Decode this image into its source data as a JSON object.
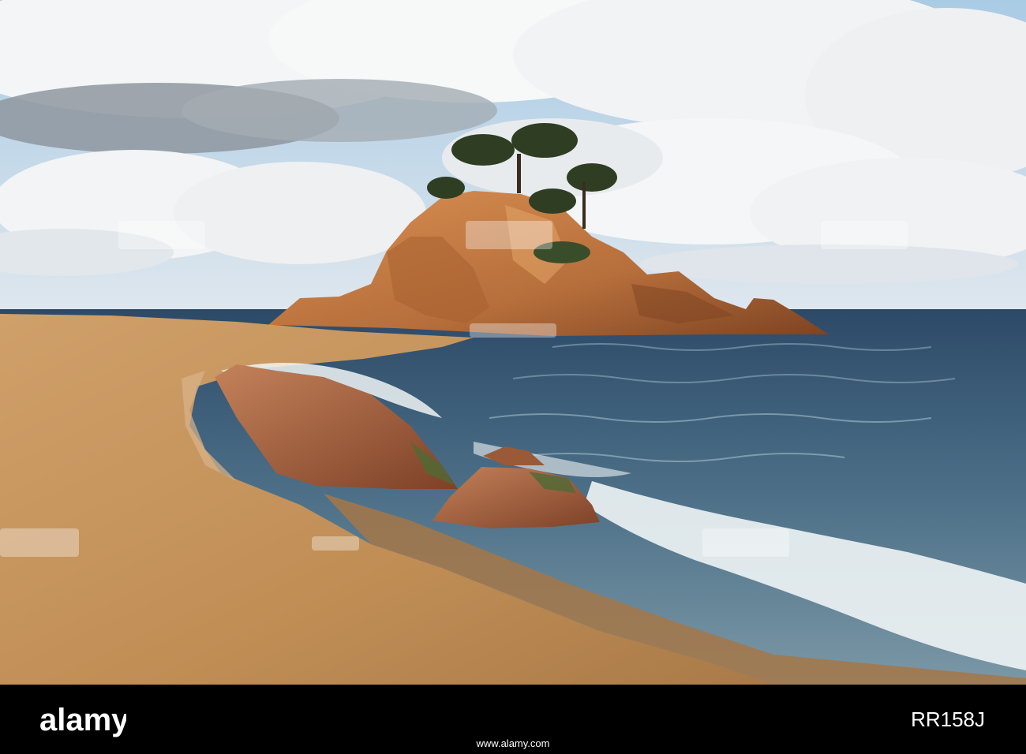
{
  "photo": {
    "description_icon": "beach-photo",
    "colors": {
      "sky_top": "#9fc3de",
      "cloud": "#f2f3f4",
      "cloud_shadow": "#8e969e",
      "sea_deep": "#2f4f6e",
      "sea_mid": "#5d7f96",
      "foam": "#eef4f5",
      "sand": "#c8965a",
      "sand_wet": "#b5834c",
      "rock": "#c07a45",
      "rock_dark": "#8a4d2a",
      "tree": "#2e3d22"
    }
  },
  "watermark": {
    "brand": "alamy",
    "caption": "www.alamy.com",
    "image_id": "RR158J"
  }
}
